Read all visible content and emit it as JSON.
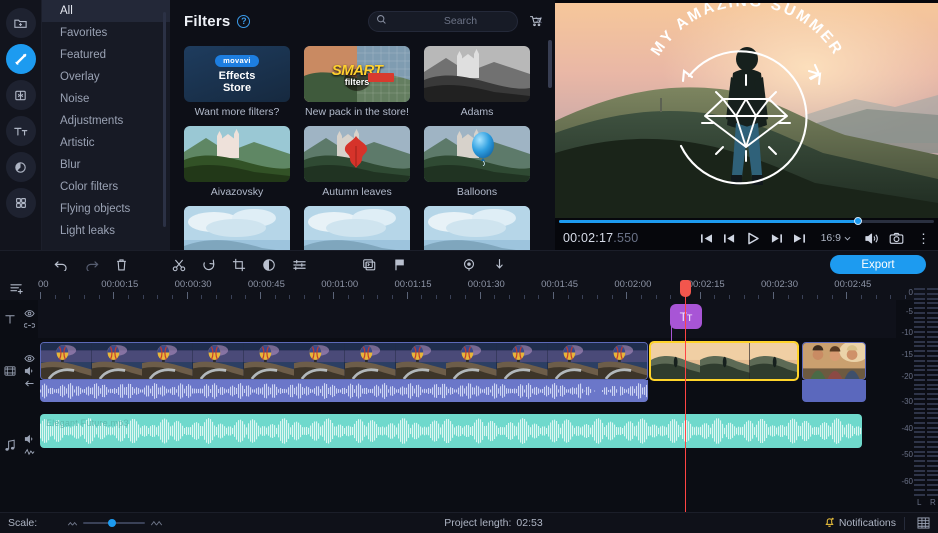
{
  "app": {
    "accent": "#1d9bf0",
    "selection_color": "#ffd42a",
    "playhead_color": "#ff4444"
  },
  "rail": {
    "items": [
      {
        "name": "import-media",
        "icon": "folder-plus-icon",
        "active": false
      },
      {
        "name": "filters",
        "icon": "magic-wand-icon",
        "active": true
      },
      {
        "name": "transitions",
        "icon": "transition-icon",
        "active": false
      },
      {
        "name": "titles",
        "icon": "titles-icon",
        "active": false
      },
      {
        "name": "stickers",
        "icon": "sticker-icon",
        "active": false
      },
      {
        "name": "more-tools",
        "icon": "grid-icon",
        "active": false
      }
    ]
  },
  "categories": {
    "items": [
      {
        "label": "All",
        "selected": true
      },
      {
        "label": "Favorites",
        "selected": false
      },
      {
        "label": "Featured",
        "selected": false
      },
      {
        "label": "Overlay",
        "selected": false
      },
      {
        "label": "Noise",
        "selected": false
      },
      {
        "label": "Adjustments",
        "selected": false
      },
      {
        "label": "Artistic",
        "selected": false
      },
      {
        "label": "Blur",
        "selected": false
      },
      {
        "label": "Color filters",
        "selected": false
      },
      {
        "label": "Flying objects",
        "selected": false
      },
      {
        "label": "Light leaks",
        "selected": false
      }
    ]
  },
  "filters_panel": {
    "title": "Filters",
    "help_label": "?",
    "search": {
      "value": "",
      "placeholder": "Search",
      "clear_label": "✕"
    },
    "cart_icon": "cart-icon",
    "items": [
      {
        "caption": "Want more filters?",
        "kind": "store",
        "store_brand": "movavi",
        "store_line1": "Effects",
        "store_line2": "Store"
      },
      {
        "caption": "New pack in the store!",
        "kind": "promo",
        "promo_line1": "SMART",
        "promo_line2": "filters"
      },
      {
        "caption": "Adams",
        "kind": "filter"
      },
      {
        "caption": "Aivazovsky",
        "kind": "filter"
      },
      {
        "caption": "Autumn leaves",
        "kind": "filter"
      },
      {
        "caption": "Balloons",
        "kind": "filter"
      }
    ]
  },
  "preview": {
    "overlay_title": "MY AMAZING SUMMER",
    "timecode": "00:02:17",
    "timecode_ms": ".550",
    "aspect_ratio": "16:9",
    "progress_percent": 79,
    "controls": [
      {
        "name": "go-to-start-button",
        "icon": "skip-start-icon"
      },
      {
        "name": "previous-frame-button",
        "icon": "step-back-icon"
      },
      {
        "name": "play-button",
        "icon": "play-icon"
      },
      {
        "name": "next-frame-button",
        "icon": "step-forward-icon"
      },
      {
        "name": "go-to-end-button",
        "icon": "skip-end-icon"
      }
    ],
    "volume_icon": "speaker-icon",
    "snapshot_icon": "camera-icon",
    "more_icon": "kebab-menu-icon"
  },
  "toolbar": {
    "export_label": "Export",
    "tools": [
      {
        "name": "undo-button",
        "icon": "undo-icon",
        "dim": false
      },
      {
        "name": "redo-button",
        "icon": "redo-icon",
        "dim": true
      },
      {
        "name": "delete-button",
        "icon": "trash-icon",
        "dim": false
      },
      {
        "name": "split-button",
        "icon": "scissors-icon",
        "dim": false
      },
      {
        "name": "rotate-button",
        "icon": "rotate-icon",
        "dim": false
      },
      {
        "name": "crop-button",
        "icon": "crop-icon",
        "dim": false
      },
      {
        "name": "color-adjust-button",
        "icon": "contrast-icon",
        "dim": false
      },
      {
        "name": "properties-button",
        "icon": "sliders-icon",
        "dim": false
      },
      {
        "name": "transitions-button",
        "icon": "clip-stack-icon",
        "dim": false
      },
      {
        "name": "marker-button",
        "icon": "flag-icon",
        "dim": false
      },
      {
        "name": "pan-zoom-button",
        "icon": "target-icon",
        "dim": false
      },
      {
        "name": "record-audio-button",
        "icon": "microphone-icon",
        "dim": false
      }
    ]
  },
  "timeline": {
    "add_track_icon": "add-track-icon",
    "ruler_labels": [
      "00",
      "00:00:15",
      "00:00:30",
      "00:00:45",
      "00:01:00",
      "00:01:15",
      "00:01:30",
      "00:01:45",
      "00:02:00",
      "00:02:15",
      "00:02:30",
      "00:02:45"
    ],
    "playhead_time": "00:02:17",
    "tracks": [
      {
        "name": "title-track",
        "icon": "title-track-icon",
        "controls": [
          "eye-icon",
          "link-icon"
        ]
      },
      {
        "name": "video-track",
        "icon": "video-track-icon",
        "controls": [
          "eye-icon",
          "speaker-icon",
          "arrow-left-icon"
        ]
      },
      {
        "name": "audio-track",
        "icon": "music-note-icon",
        "controls": [
          "speaker-icon",
          "waveform-icon"
        ]
      }
    ],
    "title_clip": {
      "label": "Tт",
      "name": "title-clip"
    },
    "audio_clip_label": "Elegant Future.mp3",
    "selected_clip": "mountain-clip"
  },
  "meter": {
    "db_labels": [
      "0",
      "-5",
      "-10",
      "-15",
      "-20",
      "-30",
      "-40",
      "-50",
      "-60"
    ],
    "channel_left": "L",
    "channel_right": "R"
  },
  "status": {
    "scale_label": "Scale:",
    "project_length_label": "Project length:",
    "project_length_value": "02:53",
    "notifications_label": "Notifications",
    "notifications_icon": "bell-icon",
    "layout_icon": "layout-grid-icon"
  }
}
